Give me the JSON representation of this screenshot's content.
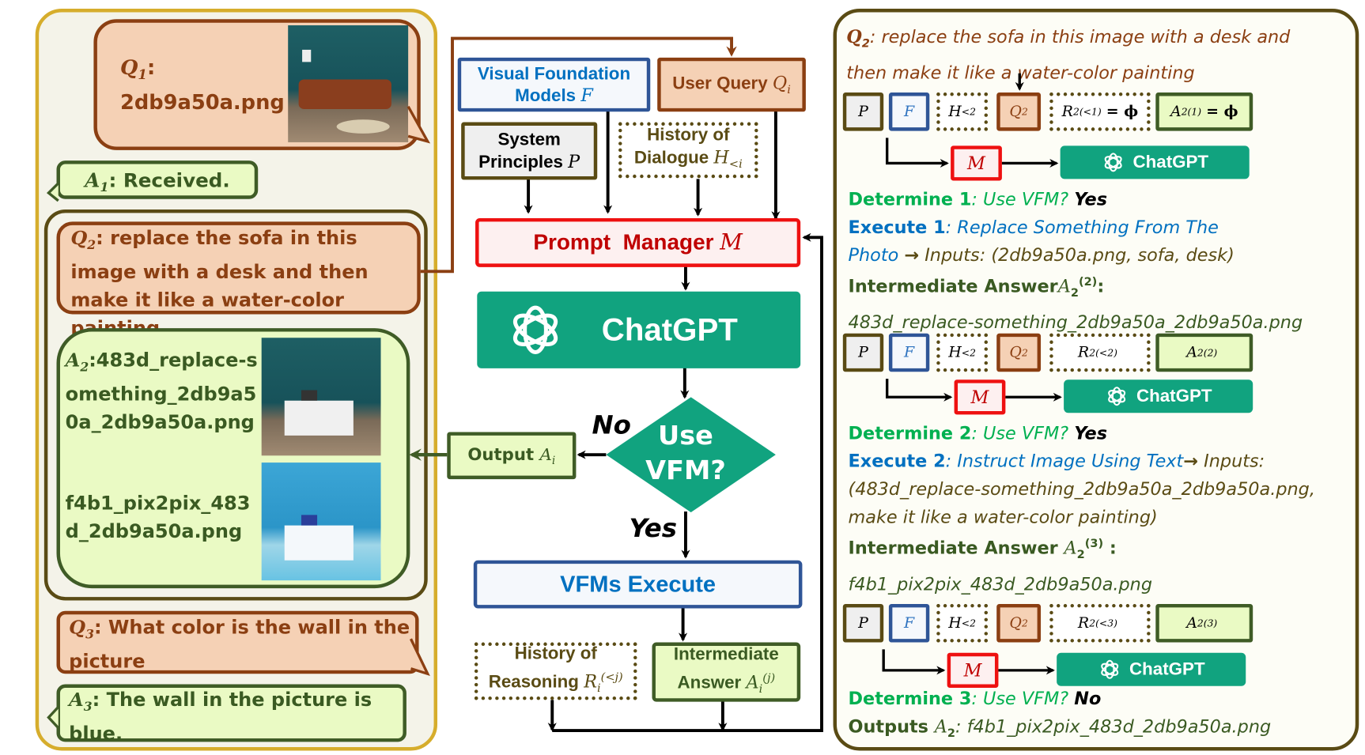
{
  "left_panel": {
    "q1": {
      "label": "Q",
      "index": "1",
      "text": "2db9a50a.png"
    },
    "a1": {
      "label": "A",
      "index": "1",
      "text": ": Received."
    },
    "q2": {
      "label": "Q",
      "index": "2",
      "text": ": replace the sofa in this image with a desk and then make it like a water-color painting"
    },
    "a2": {
      "label": "A",
      "index": "2",
      "text_1": ":483d_replace-something_2db9a50a_2db9a50a.png",
      "text_2": "f4b1_pix2pix_483d_2db9a50a.png"
    },
    "q3": {
      "label": "Q",
      "index": "3",
      "text": ": What color is the wall in the picture"
    },
    "a3": {
      "label": "A",
      "index": "3",
      "text": ": The wall in the picture is blue."
    },
    "images": [
      "sofa-room-photo",
      "desk-room-photo",
      "watercolor-desk-photo"
    ]
  },
  "center": {
    "vfm_box": {
      "line1": "Visual Foundation",
      "line2": "Models",
      "symbol": "F"
    },
    "user_query_box": {
      "text": "User Query",
      "symbol": "Q",
      "sub": "i"
    },
    "system_principles_box": {
      "line1": "System",
      "line2": "Principles",
      "symbol": "P"
    },
    "history_dialogue_box": {
      "line1": "History of",
      "line2": "Dialogue",
      "symbol": "H",
      "sub": "<i"
    },
    "prompt_manager_box": {
      "text": "Prompt  Manager",
      "symbol": "M"
    },
    "chatgpt_box": {
      "text": "ChatGPT"
    },
    "decision": {
      "line1": "Use",
      "line2": "VFM?",
      "no_label": "No",
      "yes_label": "Yes"
    },
    "output_box": {
      "text": "Output",
      "symbol": "A",
      "sub": "i"
    },
    "vfms_execute_box": {
      "text": "VFMs Execute"
    },
    "history_reasoning_box": {
      "line1": "History of",
      "line2": "Reasoning",
      "symbol": "R",
      "sub": "i",
      "sup": "(<j)"
    },
    "intermediate_answer_box": {
      "line1": "Intermediate",
      "line2": "Answer",
      "symbol": "A",
      "sub": "i",
      "sup": "(j)"
    }
  },
  "right_panel": {
    "query": {
      "label": "Q",
      "index": "2",
      "text_1": ": replace the sofa in this image with a desk and",
      "text_2": "then make it like a water-color painting"
    },
    "chatgpt_label": "ChatGPT",
    "rows": [
      {
        "p": "P",
        "f": "F",
        "h": "H",
        "h_sub": "<2",
        "q": "Q",
        "q_sub": "2",
        "r": "R",
        "r_sub": "2",
        "r_sup": "(<1)",
        "r_eq": "= ϕ",
        "a": "A",
        "a_sub": "2",
        "a_sup": "(1)",
        "a_eq": "= ϕ",
        "m": "M"
      },
      {
        "p": "P",
        "f": "F",
        "h": "H",
        "h_sub": "<2",
        "q": "Q",
        "q_sub": "2",
        "r": "R",
        "r_sub": "2",
        "r_sup": "(<2)",
        "r_eq": "",
        "a": "A",
        "a_sub": "2",
        "a_sup": "(2)",
        "a_eq": "",
        "m": "M"
      },
      {
        "p": "P",
        "f": "F",
        "h": "H",
        "h_sub": "<2",
        "q": "Q",
        "q_sub": "2",
        "r": "R",
        "r_sub": "2",
        "r_sup": "(<3)",
        "r_eq": "",
        "a": "A",
        "a_sub": "2",
        "a_sup": "(3)",
        "a_eq": "",
        "m": "M"
      }
    ],
    "step1": {
      "determine_label": "Determine 1",
      "determine_q": ": Use VFM? ",
      "determine_ans": "Yes",
      "execute_label": "Execute 1",
      "execute_tool_1": ": Replace Something From The",
      "execute_tool_2": "Photo",
      "arrow": "→",
      "inputs": " Inputs: (2db9a50a.png, sofa, desk)",
      "intermediate_label": "Intermediate Answer",
      "int_sym": "A",
      "int_sub": "2",
      "int_sup": "(2)",
      "colon": ":",
      "intermediate_value": "483d_replace-something_2db9a50a_2db9a50a.png"
    },
    "step2": {
      "determine_label": "Determine 2",
      "determine_q": ": Use VFM? ",
      "determine_ans": "Yes",
      "execute_label": "Execute 2",
      "execute_tool": ": Instruct Image Using Text",
      "arrow": "→",
      "inputs_1": " Inputs:",
      "inputs_2": "(483d_replace-something_2db9a50a_2db9a50a.png,",
      "inputs_3": "make it like a water-color painting)",
      "intermediate_label": "Intermediate Answer ",
      "int_sym": "A",
      "int_sub": "2",
      "int_sup": "(3)",
      "colon": " :",
      "intermediate_value": "f4b1_pix2pix_483d_2db9a50a.png"
    },
    "step3": {
      "determine_label": "Determine 3",
      "determine_q": ": Use VFM? ",
      "determine_ans": "No",
      "outputs_label": "Outputs ",
      "out_sym": "A",
      "out_sub": "2",
      "outputs_value": ": f4b1_pix2pix_483d_2db9a50a.png"
    }
  },
  "colors": {
    "query_fill": "#f5d1b5",
    "query_border": "#8b3f12",
    "answer_fill": "#eafac4",
    "answer_border": "#3f5c26",
    "chatgpt_green": "#11a37f",
    "prompt_red": "#ee1111",
    "vfm_blue": "#2f5597",
    "determine_green": "#00b050",
    "execute_blue": "#0070c0",
    "left_panel_border": "#d6ad2c",
    "right_panel_border": "#5a4b14"
  }
}
